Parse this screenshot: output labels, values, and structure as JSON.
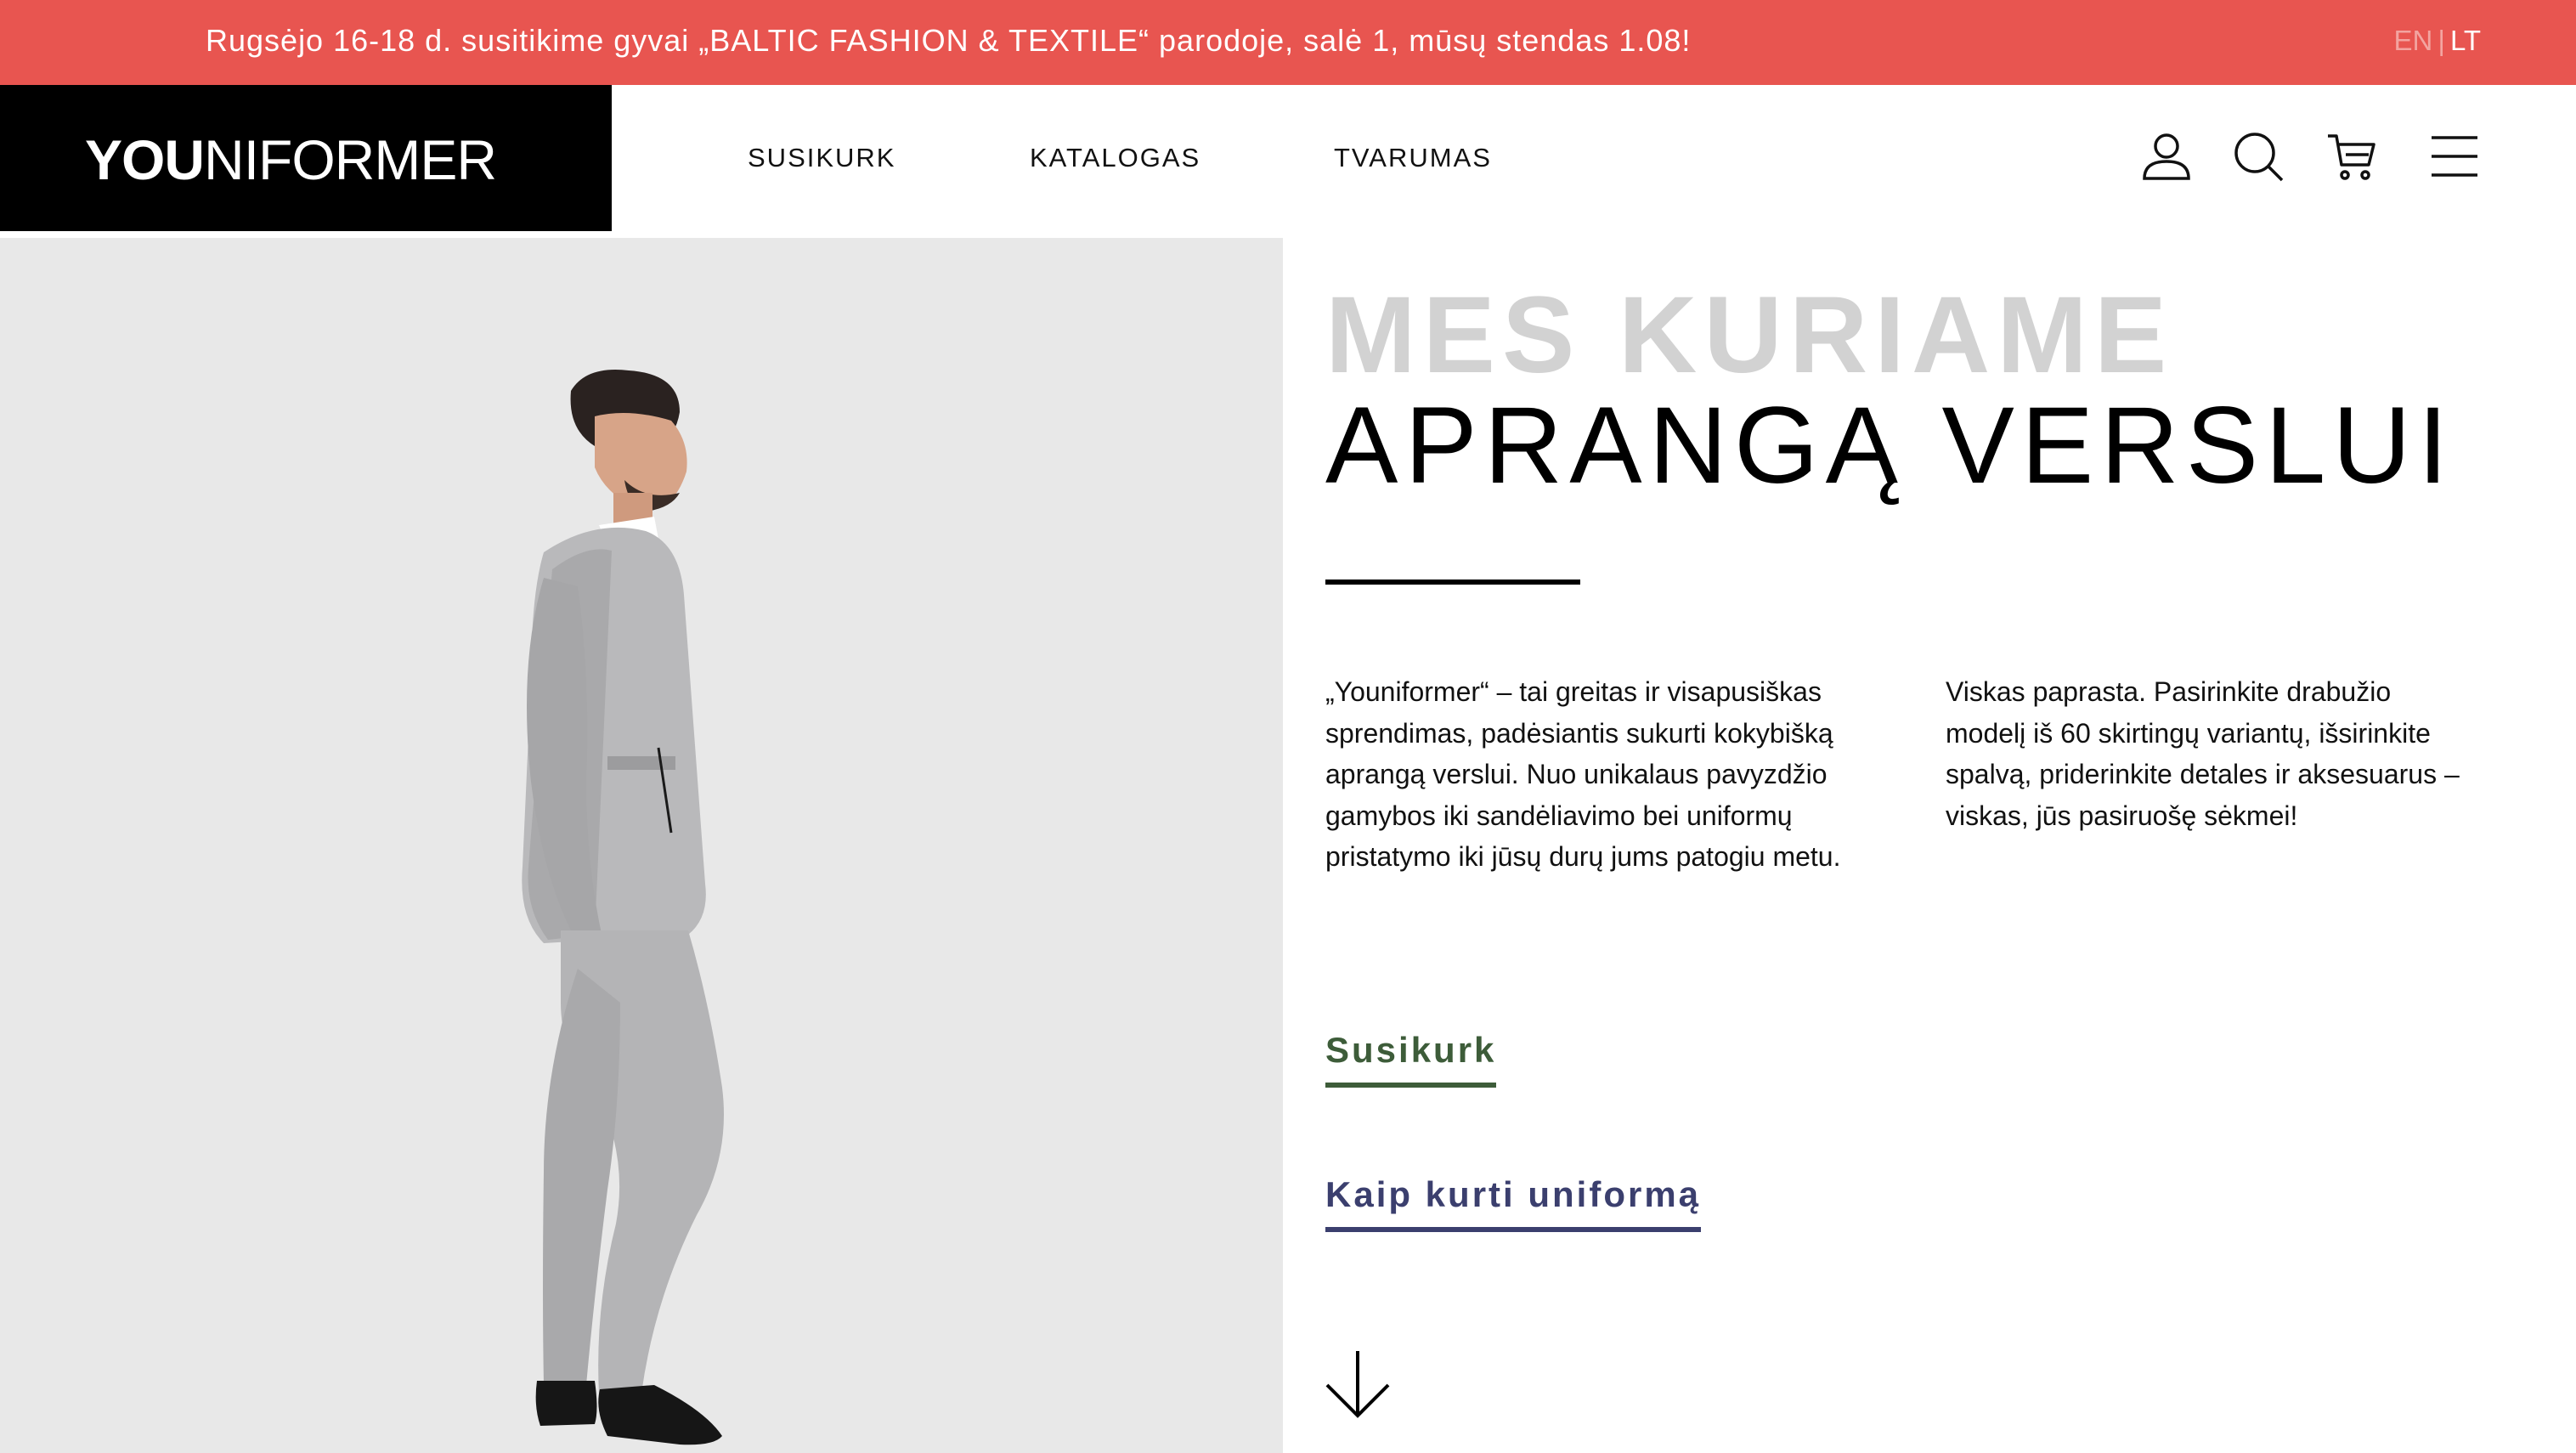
{
  "announcement": {
    "text": "Rugsėjo 16-18 d. susitikime gyvai „BALTIC FASHION & TEXTILE“ parodoje, salė 1, mūsų stendas 1.08!",
    "lang_en": "EN",
    "lang_separator": "|",
    "lang_lt": "LT"
  },
  "header": {
    "logo_bold": "YOU",
    "logo_thin": "NIFORMER",
    "nav": [
      "SUSIKURK",
      "KATALOGAS",
      "TVARUMAS"
    ],
    "icons": [
      "user-icon",
      "search-icon",
      "cart-icon",
      "menu-icon"
    ]
  },
  "hero": {
    "subtitle": "MES KURIAME",
    "title": "APRANGĄ VERSLUI",
    "paragraph_left": "„Youniformer“ – tai greitas ir visapusiškas sprendimas, padėsiantis sukurti kokybišką aprangą verslui. Nuo unikalaus pavyzdžio gamybos iki sandėliavimo bei uniformų pristatymo iki jūsų durų jums patogiu metu.",
    "paragraph_right": "Viskas paprasta. Pasirinkite drabužio modelį iš 60 skirtingų variantų, išsirinkite spalvą, priderinkite detales ir aksesuarus – viskas, jūs pasiruošę sėkmei!",
    "cta_primary": "Susikurk",
    "cta_secondary": "Kaip kurti uniformą",
    "scroll_icon": "arrow-down-icon"
  },
  "colors": {
    "announcement_bg": "#e85550",
    "logo_bg": "#000000",
    "image_bg": "#e8e8e8",
    "cta_primary": "#3d5c39",
    "cta_secondary": "#3b3f6e",
    "subtitle_grey": "#d2d2d2"
  }
}
